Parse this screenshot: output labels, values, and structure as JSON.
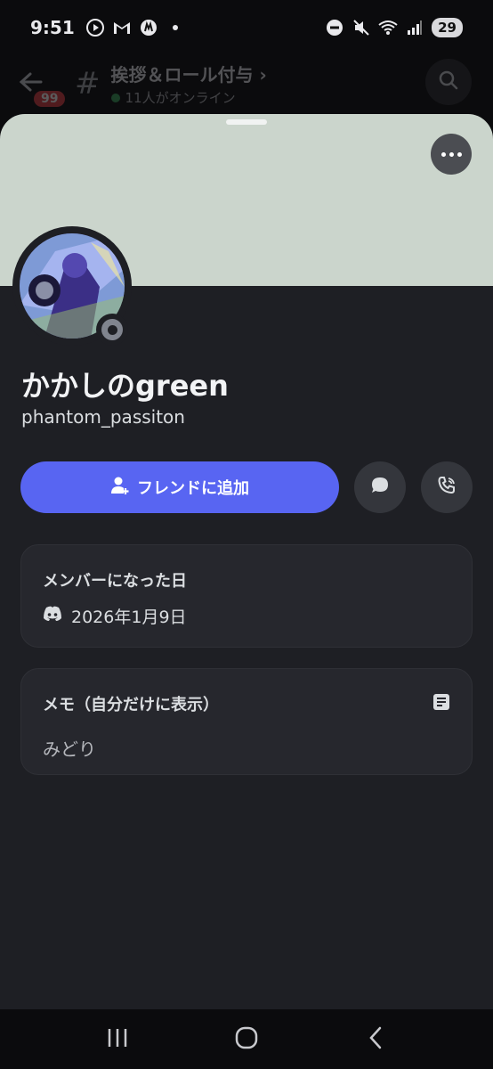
{
  "status_bar": {
    "time": "9:51",
    "battery": "29"
  },
  "channel_header": {
    "title": "挨拶＆ロール付与",
    "chevron": "›",
    "subtitle": "11人がオンライン",
    "badge_count": "99"
  },
  "profile": {
    "display_name": "かかしのgreen",
    "username": "phantom_passiton",
    "status": "offline"
  },
  "actions": {
    "add_friend_label": "フレンドに追加"
  },
  "member_since": {
    "title": "メンバーになった日",
    "date": "2026年1月9日"
  },
  "note": {
    "title": "メモ（自分だけに表示）",
    "text": "みどり"
  },
  "colors": {
    "accent": "#5865f2",
    "banner": "#cbd5cc",
    "sheet_bg": "#1e1f24",
    "card_bg": "#26272d",
    "online": "#3ba55d",
    "badge": "#e03f44"
  },
  "icons": {
    "status": [
      "play-icon",
      "gmail-icon",
      "m-icon",
      "dot-icon",
      "dnd-icon",
      "mute-icon",
      "wifi-icon",
      "signal-icon"
    ],
    "header": [
      "back-arrow-icon",
      "hash-icon",
      "search-icon"
    ],
    "sheet": [
      "more-icon",
      "add-friend-icon",
      "message-icon",
      "call-icon",
      "discord-icon",
      "note-icon"
    ],
    "nav": [
      "recents-icon",
      "home-icon",
      "back-icon"
    ]
  }
}
